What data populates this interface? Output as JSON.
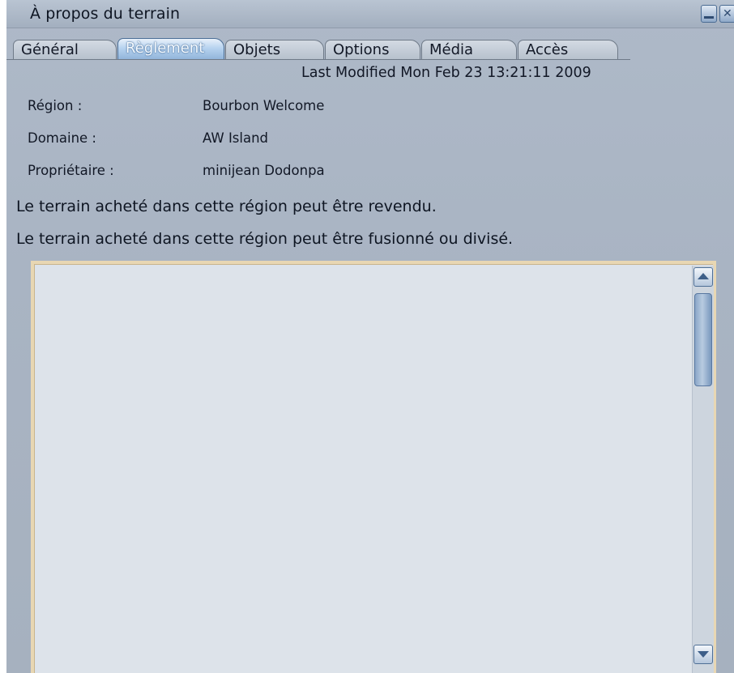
{
  "window": {
    "title": "À propos du terrain",
    "minimize_icon": "minimize-icon",
    "close_icon": "close-icon"
  },
  "tabs": [
    {
      "label": "Général",
      "active": false
    },
    {
      "label": "Règlement",
      "active": true
    },
    {
      "label": "Objets",
      "active": false
    },
    {
      "label": "Options",
      "active": false
    },
    {
      "label": "Média",
      "active": false
    },
    {
      "label": "Accès",
      "active": false
    }
  ],
  "last_modified": "Last Modified Mon Feb 23 13:21:11 2009",
  "fields": [
    {
      "label": "Région :",
      "value": "Bourbon Welcome"
    },
    {
      "label": "Domaine :",
      "value": "AW Island"
    },
    {
      "label": "Propriétaire :",
      "value": "minijean Dodonpa"
    }
  ],
  "statements": [
    "Le terrain acheté dans cette région peut être revendu.",
    "Le terrain acheté dans cette région peut être fusionné ou divisé."
  ],
  "covenant_text": "",
  "colors": {
    "window_bg": "#a9b4c3",
    "active_tab": "#8fb3d9",
    "textbox_border": "#e8d7b3",
    "textbox_bg": "#dde3ea"
  }
}
